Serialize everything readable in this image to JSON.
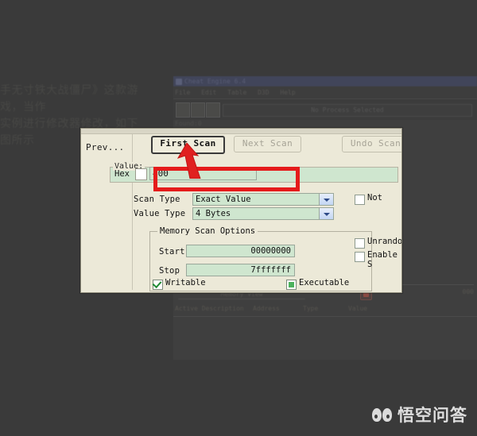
{
  "page": {
    "caption_lines": "手无寸铁大战僵尸》这款游戏，当作\n实例进行修改器修改，如下图所示",
    "watermark_text": "悟空问答",
    "watermark_logo": "monkey-face-logo"
  },
  "background_window": {
    "title": "Cheat Engine 6.4",
    "menu": [
      "File",
      "Edit",
      "Table",
      "D3D",
      "Help"
    ],
    "process_bar_text": "No Process Selected",
    "toolbar_icons": [
      "open-process-icon",
      "open-file-icon",
      "save-file-icon"
    ],
    "memory_view_label": "Memory View",
    "table": {
      "columns": [
        "Active  Description",
        "Address",
        "Type",
        "Value"
      ]
    },
    "right_count": "000"
  },
  "dialog": {
    "prev_button_label": "Prev...",
    "buttons": {
      "first_scan": "First Scan",
      "next_scan": "Next Scan",
      "undo_scan": "Undo Scan"
    },
    "value_group_label": "Value:",
    "hex_label": "Hex",
    "hex_checked": false,
    "value_input": "400",
    "scan_type_label": "Scan Type",
    "scan_type_value": "Exact Value",
    "value_type_label": "Value Type",
    "value_type_value": "4 Bytes",
    "not_label": "Not",
    "memory_scan_options": {
      "group_title": "Memory Scan Options",
      "start_label": "Start",
      "start_value": "00000000",
      "stop_label": "Stop",
      "stop_value": "7fffffff",
      "unrandomizer_label": "Unrandom",
      "enable_speedhack_label": "Enable S",
      "writable_label": "Writable",
      "executable_label": "Executable"
    }
  },
  "annotations": {
    "highlight_rect_target": "hex-value-field",
    "arrow_target": "first-scan-button",
    "accent_color": "#e51b1b"
  }
}
